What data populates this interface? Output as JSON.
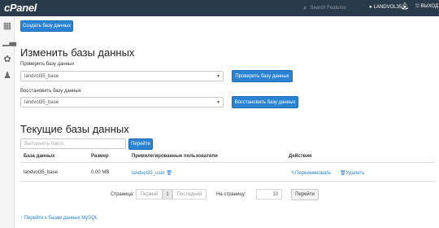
{
  "topbar": {
    "logo": "cPanel",
    "search_placeholder": "Search Features",
    "user": "LANDVOL35",
    "logout": "ВЫХОД"
  },
  "sidebar": {
    "icons": [
      "grid-icon",
      "chart-icon",
      "palette-icon",
      "users-icon"
    ]
  },
  "create_button": "Создать базу данных",
  "modify": {
    "title": "Изменить базы данных",
    "check_label": "Проверить базу данных",
    "check_value": "landvol35_base",
    "check_button": "Проверить базу данных",
    "repair_label": "Восстановить базу данных",
    "repair_value": "landvol35_base",
    "repair_button": "Восстановить базу данных"
  },
  "current": {
    "title": "Текущие базы данных",
    "search_placeholder": "Выполнить поиск",
    "go_button": "Перейти",
    "columns": [
      "База данных",
      "Размер",
      "Привилегированные пользователи",
      "Действия"
    ],
    "rows": [
      {
        "db": "landvol35_base",
        "size": "0.00 MB",
        "user": "landvol35_user",
        "rename": "Переименовать",
        "delete": "Удалить"
      }
    ]
  },
  "pagination": {
    "page_label": "Страница:",
    "first": "Первый",
    "current": "1",
    "last": "Последний",
    "per_page_label": "На страницу:",
    "per_page_value": "10",
    "go_button": "Перейти"
  },
  "back_link": "Перейти к базам данных MySQL"
}
